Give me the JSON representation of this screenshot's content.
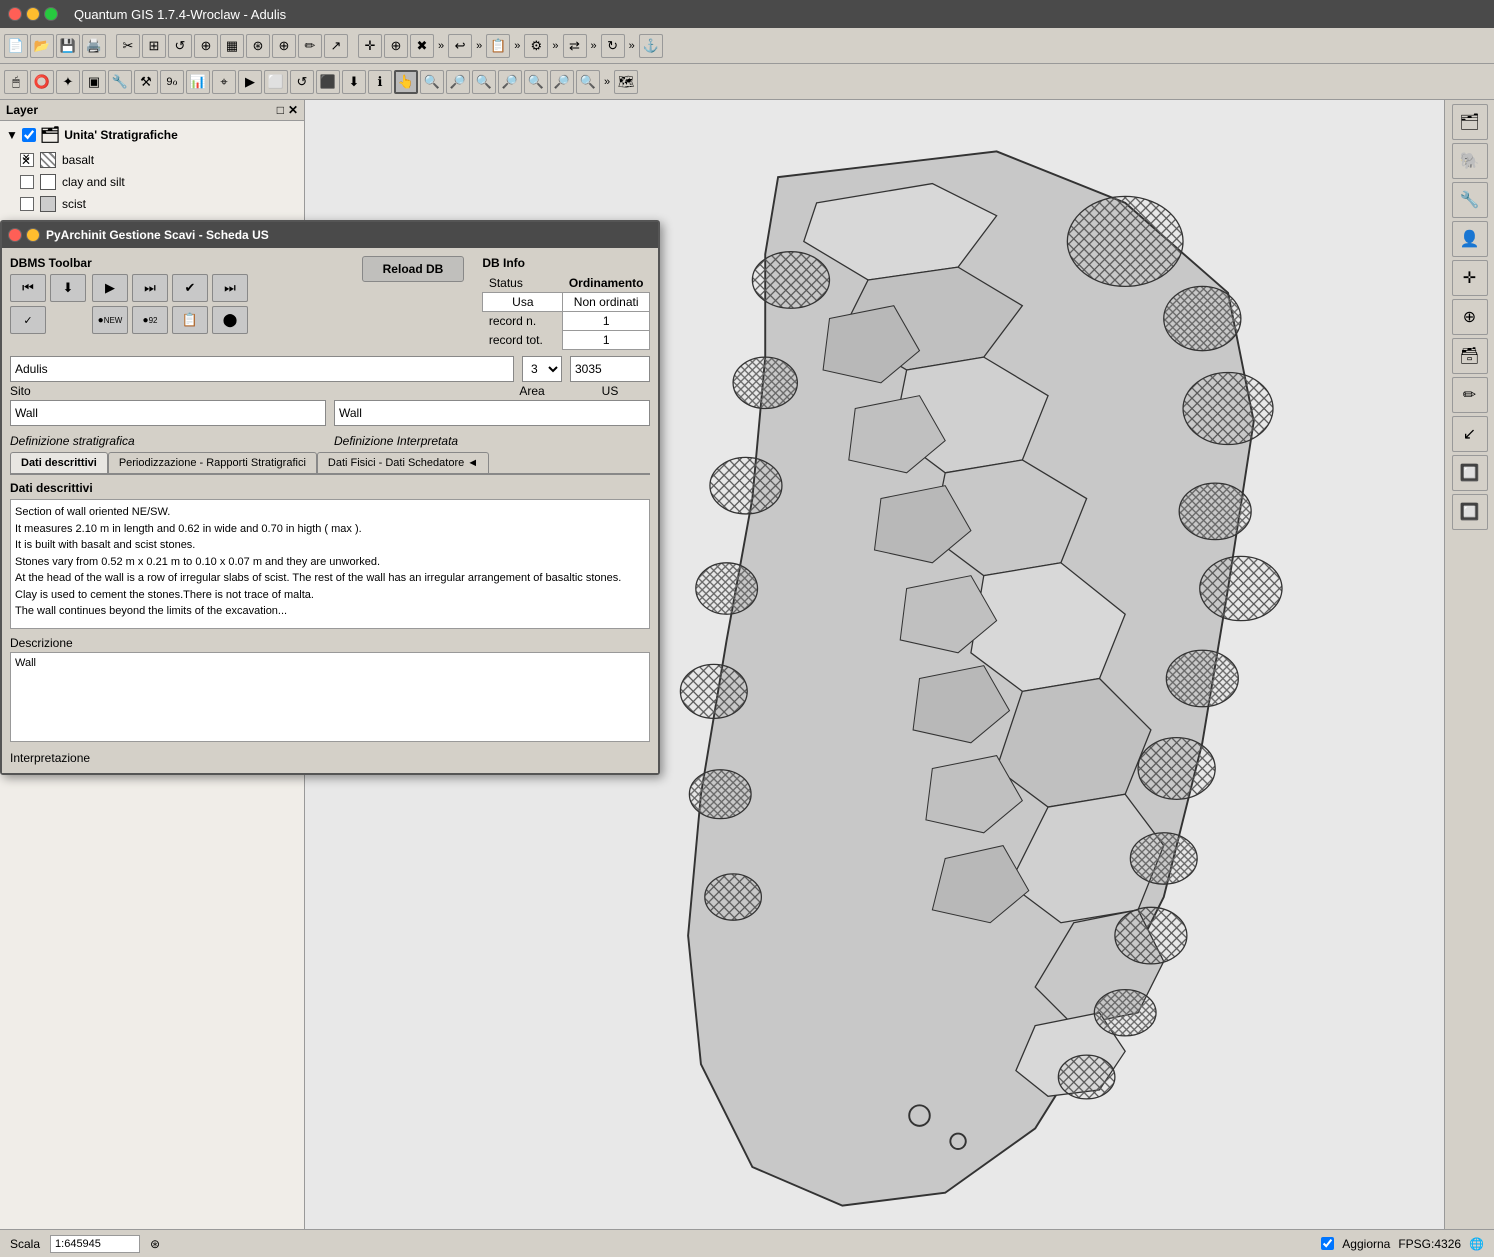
{
  "titleBar": {
    "title": "Quantum GIS 1.7.4-Wroclaw - Adulis",
    "close": "●",
    "min": "●",
    "max": "●"
  },
  "toolbar1": {
    "icons": [
      "📄",
      "📂",
      "💾",
      "🖨️",
      "✂️",
      "📋",
      "⬛",
      "🔍",
      "🗺️",
      "🔧",
      "📌",
      "🔗",
      "✏️",
      "🖱️",
      "⊕",
      "⊗",
      "»",
      "↩",
      "»",
      "📋",
      "»",
      "⚙️",
      "»",
      "🔀",
      "»"
    ]
  },
  "toolbar2": {
    "icons": [
      "🖱️",
      "⭕",
      "🐾",
      "🖼️",
      "⚒️",
      "🔧",
      "9f",
      "📊",
      "🎯",
      "🏃",
      "🔲",
      "🔄",
      "⬛",
      "🔃",
      "ℹ️",
      "👆",
      "🔍",
      "🔎",
      "🔍",
      "🔎",
      "🔍",
      "🔎",
      "🔍",
      "»",
      "🗺️"
    ]
  },
  "layerPanel": {
    "title": "Layer",
    "headerIcons": [
      "□",
      "✕"
    ],
    "group": {
      "name": "Unita' Stratigrafiche",
      "checked": true,
      "items": [
        {
          "name": "basalt",
          "swatch": "basalt"
        },
        {
          "name": "clay and silt",
          "swatch": "clay"
        },
        {
          "name": "scist",
          "swatch": "scist"
        }
      ]
    }
  },
  "dialog": {
    "title": "PyArchinit Gestione Scavi - Scheda US",
    "dbmsToolbar": {
      "label": "DBMS Toolbar",
      "reloadBtn": "Reload DB",
      "navButtons": [
        "⏮",
        "⬇",
        "▶",
        "⏭",
        "✓",
        "⏭"
      ],
      "actionButtons": [
        "⬤NEW",
        "⬤92",
        "📋",
        "⬤"
      ]
    },
    "dbInfo": {
      "title": "DB Info",
      "statusLabel": "Status",
      "ordinamentoLabel": "Ordinamento",
      "statusValue": "Usa",
      "ordinamentoValue": "Non ordinati",
      "recordNLabel": "record n.",
      "recordNValue": "1",
      "recordTotLabel": "record tot.",
      "recordTotValue": "1"
    },
    "sito": {
      "label": "Sito",
      "value": "Adulis",
      "areaLabel": "Area",
      "areaNum": "3",
      "usLabel": "US",
      "usValue": "3035"
    },
    "wallDropdowns": {
      "label1": "Wall",
      "label2": "Wall"
    },
    "defStratigrafica": "Definizione stratigrafica",
    "defInterpretata": "Definizione Interpretata",
    "tabs": [
      {
        "label": "Dati descrittivi",
        "active": true
      },
      {
        "label": "Periodizzazione - Rapporti Stratigrafici",
        "active": false
      },
      {
        "label": "Dati Fisici - Dati Schedatore ◄",
        "active": false
      }
    ],
    "datiDescrittivi": {
      "sectionTitle": "Dati descrittivi",
      "textContent": "Section of wall oriented NE/SW.\nIt measures 2.10 m in length and 0.62 in wide and 0.70 in higth ( max ).\nIt is built with basalt and scist stones.\nStones vary from 0.52 m x 0.21 m to 0.10 x 0.07 m and they are unworked.\nAt the head of the wall is a row of irregular slabs of scist. The rest of the wall has an irregular arrangement of basaltic stones.\nClay is used to cement the stones.There is not trace of malta.\nThe wall continues beyond the limits of the excavation...",
      "descrizioneLabel": "Descrizione",
      "descrizioneValue": "Wall",
      "interpretazioneLabel": "Interpretazione"
    }
  },
  "statusBar": {
    "scalaLabel": "Scala",
    "scalaValue": "1:645945",
    "aggiornaLabel": "Aggiorna",
    "fpsgLabel": "FPSG:4326"
  }
}
